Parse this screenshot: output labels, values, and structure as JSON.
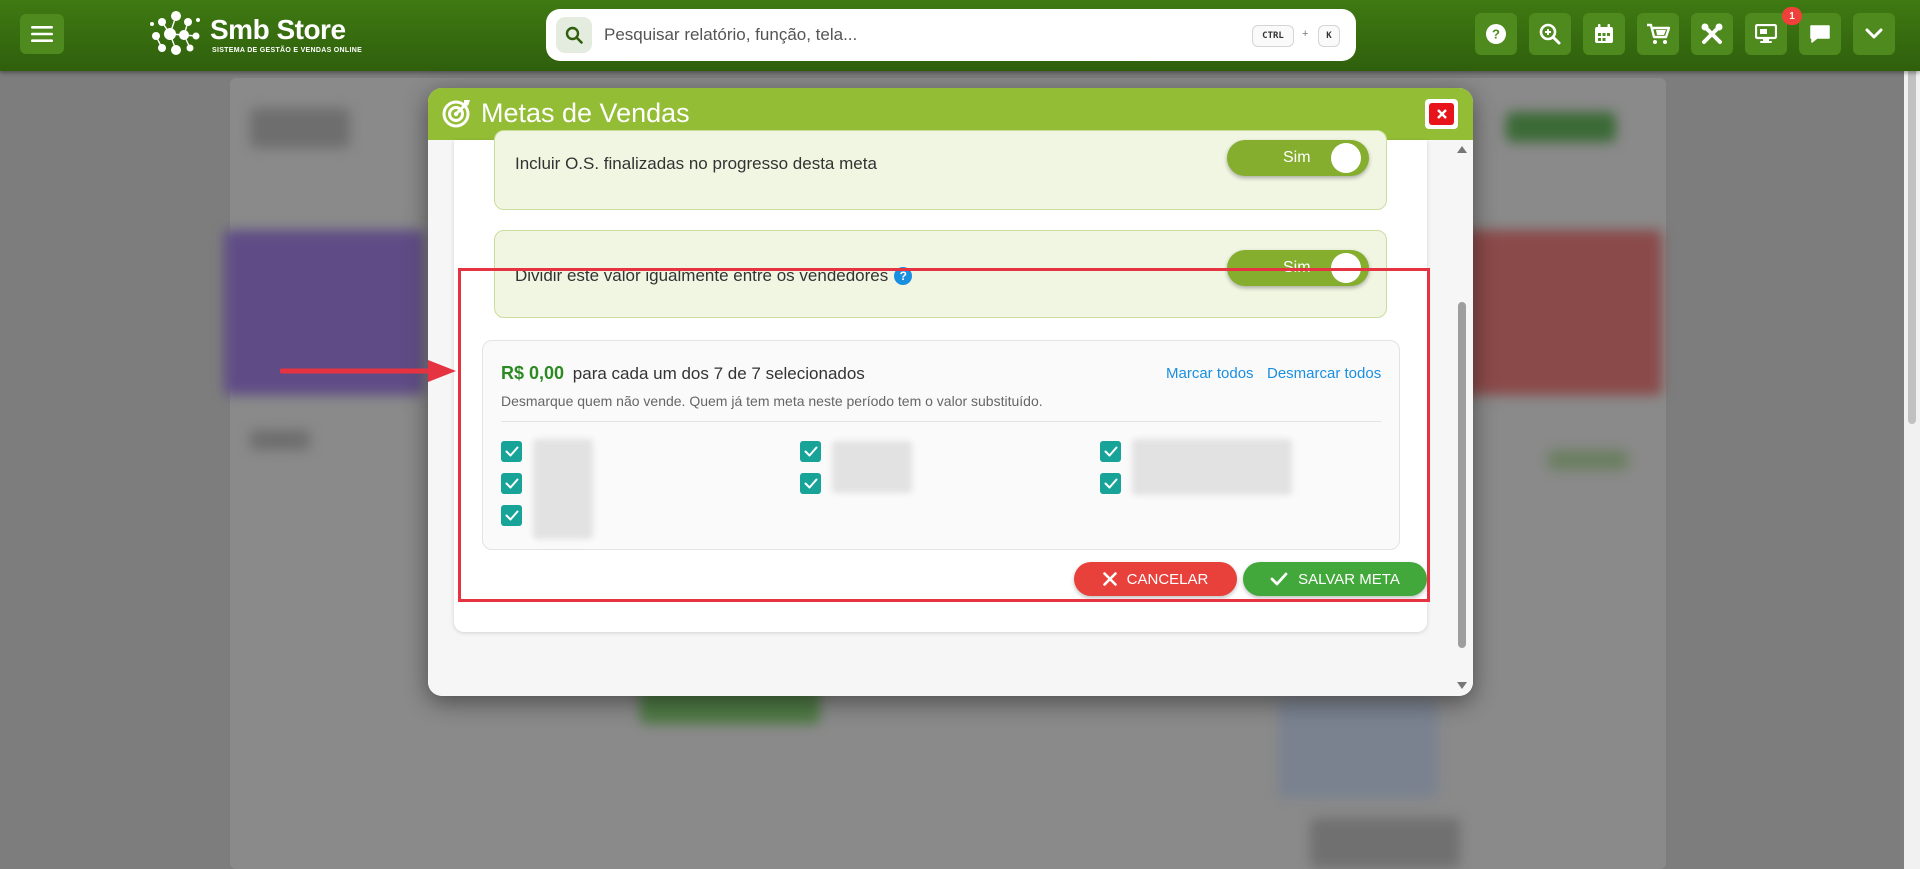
{
  "topbar": {
    "brand_name": "Smb Store",
    "brand_subtitle": "SISTEMA DE GESTÃO E VENDAS ONLINE",
    "search_placeholder": "Pesquisar relatório, função, tela...",
    "shortcut_key_1": "CTRL",
    "shortcut_plus": "+",
    "shortcut_key_2": "K",
    "notification_count": "1",
    "icons": [
      "menu-icon",
      "search-icon",
      "help-icon",
      "zoom-icon",
      "calendar-icon",
      "cart-icon",
      "tools-icon",
      "monitor-icon",
      "chat-icon",
      "chevron-down-icon"
    ]
  },
  "modal": {
    "title": "Metas de Vendas",
    "include_os_label": "Incluir O.S. finalizadas no progresso desta meta",
    "include_os_toggle": "Sim",
    "split_label": "Dividir este valor igualmente entre os vendedores",
    "split_toggle": "Sim",
    "sellers": {
      "amount": "R$ 0,00",
      "amount_suffix": "para cada um dos 7 de 7 selecionados",
      "select_all": "Marcar todos",
      "deselect_all": "Desmarcar todos",
      "hint": "Desmarque quem não vende. Quem já tem meta neste período tem o valor substituído.",
      "checked_count": 7
    },
    "cancel_label": "CANCELAR",
    "save_label": "SALVAR META"
  },
  "colors": {
    "topbar": "#3f7a12",
    "modal_header": "#93bd34",
    "toggle": "#85ad2e",
    "checkbox": "#17a398",
    "cancel": "#e8403a",
    "save": "#43a83b",
    "highlight": "#e53342",
    "link": "#1a8fe0"
  }
}
